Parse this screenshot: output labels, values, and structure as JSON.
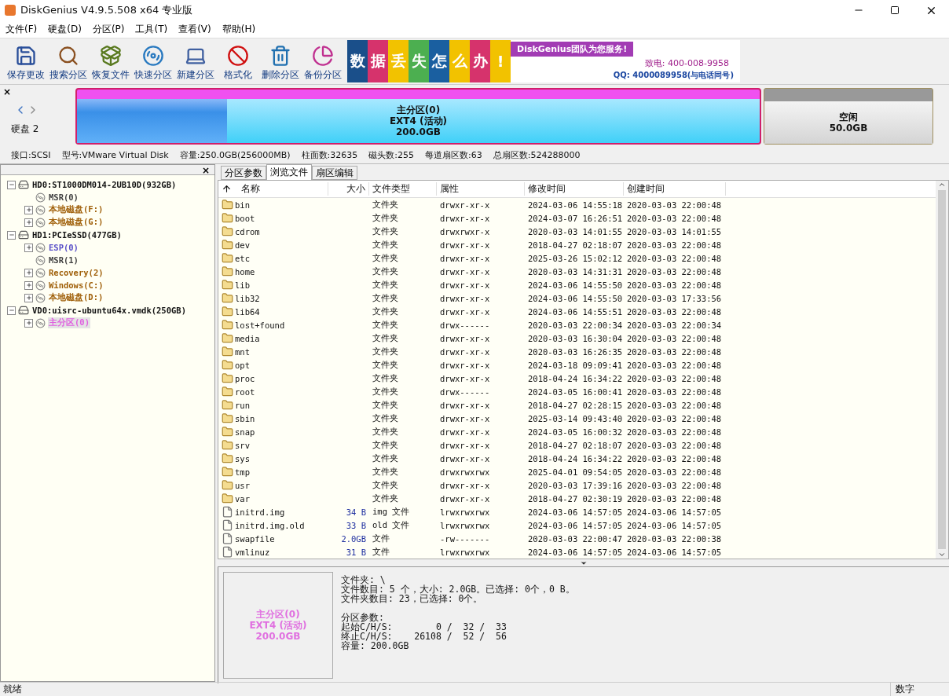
{
  "window": {
    "title": "DiskGenius V4.9.5.508 x64 专业版"
  },
  "menu": [
    "文件(F)",
    "硬盘(D)",
    "分区(P)",
    "工具(T)",
    "查看(V)",
    "帮助(H)"
  ],
  "toolbar": [
    {
      "label": "保存更改",
      "kind": "save"
    },
    {
      "label": "搜索分区",
      "kind": "search"
    },
    {
      "label": "恢复文件",
      "kind": "recover"
    },
    {
      "label": "快速分区",
      "kind": "quick"
    },
    {
      "label": "新建分区",
      "kind": "new"
    },
    {
      "label": "格式化",
      "kind": "format"
    },
    {
      "label": "删除分区",
      "kind": "delete"
    },
    {
      "label": "备份分区",
      "kind": "backup"
    }
  ],
  "banner": {
    "tiles": [
      {
        "text": "数",
        "color": "#1a4f8a"
      },
      {
        "text": "据",
        "color": "#d6336c"
      },
      {
        "text": "丢",
        "color": "#f2c200"
      },
      {
        "text": "失",
        "color": "#4caf50"
      },
      {
        "text": "怎",
        "color": "#1a5fa0"
      },
      {
        "text": "么",
        "color": "#f2c200"
      },
      {
        "text": "办",
        "color": "#d6336c"
      },
      {
        "text": "!",
        "color": "#f2c200"
      }
    ],
    "slogan": "DiskGenius团队为您服务!",
    "phone": "致电: 400-008-9958",
    "qq": "QQ: 4000089958(与电话同号)"
  },
  "disk_bar": {
    "close": "×",
    "disk_label": "硬盘 2",
    "partitions": [
      {
        "kind": "used",
        "name": "主分区(0)",
        "fs": "EXT4 (活动)",
        "size": "200.0GB",
        "level": 0.22
      },
      {
        "kind": "free",
        "name": "空闲",
        "size": "50.0GB"
      }
    ],
    "info": [
      "接口:SCSI",
      "型号:VMware Virtual Disk",
      "容量:250.0GB(256000MB)",
      "柱面数:32635",
      "磁头数:255",
      "每道扇区数:63",
      "总扇区数:524288000"
    ]
  },
  "tree": {
    "close": "×",
    "items": [
      {
        "label": "HD0:ST1000DM014-2UB10D(932GB)",
        "kind": "disk",
        "expanded": true,
        "selected": false,
        "children": [
          {
            "label": "MSR(0)",
            "kind": "reserved",
            "selected": false,
            "color": "#404040"
          },
          {
            "label": "本地磁盘(F:)",
            "kind": "partition",
            "expanded": false,
            "selected": false,
            "color": "#a0600a"
          },
          {
            "label": "本地磁盘(G:)",
            "kind": "partition",
            "expanded": false,
            "selected": false,
            "color": "#a0600a"
          }
        ]
      },
      {
        "label": "HD1:PCIeSSD(477GB)",
        "kind": "disk",
        "expanded": true,
        "selected": false,
        "children": [
          {
            "label": "ESP(0)",
            "kind": "partition",
            "expanded": false,
            "selected": false,
            "color": "#5a50c8"
          },
          {
            "label": "MSR(1)",
            "kind": "reserved",
            "selected": false,
            "color": "#404040"
          },
          {
            "label": "Recovery(2)",
            "kind": "partition",
            "expanded": false,
            "selected": false,
            "color": "#a0600a"
          },
          {
            "label": "Windows(C:)",
            "kind": "partition",
            "expanded": false,
            "selected": false,
            "color": "#a0600a"
          },
          {
            "label": "本地磁盘(D:)",
            "kind": "partition",
            "expanded": false,
            "selected": false,
            "color": "#a0600a"
          }
        ]
      },
      {
        "label": "VD0:uisrc-ubuntu64x.vmdk(250GB)",
        "kind": "disk",
        "expanded": true,
        "selected": false,
        "children": [
          {
            "label": "主分区(0)",
            "kind": "partition",
            "expanded": false,
            "selected": true,
            "color": "#e060e0"
          }
        ]
      }
    ]
  },
  "tabs": [
    {
      "label": "分区参数",
      "selected": false
    },
    {
      "label": "浏览文件",
      "selected": true
    },
    {
      "label": "扇区编辑",
      "selected": false
    }
  ],
  "table": {
    "columns": [
      "名称",
      "大小",
      "文件类型",
      "属性",
      "修改时间",
      "创建时间"
    ],
    "rows": [
      {
        "kind": "folder",
        "name": "bin",
        "size": "",
        "type": "文件夹",
        "attr": "drwxr-xr-x",
        "modified": "2024-03-06 14:55:18",
        "created": "2020-03-03 22:00:48"
      },
      {
        "kind": "folder",
        "name": "boot",
        "size": "",
        "type": "文件夹",
        "attr": "drwxr-xr-x",
        "modified": "2024-03-07 16:26:51",
        "created": "2020-03-03 22:00:48"
      },
      {
        "kind": "folder",
        "name": "cdrom",
        "size": "",
        "type": "文件夹",
        "attr": "drwxrwxr-x",
        "modified": "2020-03-03 14:01:55",
        "created": "2020-03-03 14:01:55"
      },
      {
        "kind": "folder",
        "name": "dev",
        "size": "",
        "type": "文件夹",
        "attr": "drwxr-xr-x",
        "modified": "2018-04-27 02:18:07",
        "created": "2020-03-03 22:00:48"
      },
      {
        "kind": "folder",
        "name": "etc",
        "size": "",
        "type": "文件夹",
        "attr": "drwxr-xr-x",
        "modified": "2025-03-26 15:02:12",
        "created": "2020-03-03 22:00:48"
      },
      {
        "kind": "folder",
        "name": "home",
        "size": "",
        "type": "文件夹",
        "attr": "drwxr-xr-x",
        "modified": "2020-03-03 14:31:31",
        "created": "2020-03-03 22:00:48"
      },
      {
        "kind": "folder",
        "name": "lib",
        "size": "",
        "type": "文件夹",
        "attr": "drwxr-xr-x",
        "modified": "2024-03-06 14:55:50",
        "created": "2020-03-03 22:00:48"
      },
      {
        "kind": "folder",
        "name": "lib32",
        "size": "",
        "type": "文件夹",
        "attr": "drwxr-xr-x",
        "modified": "2024-03-06 14:55:50",
        "created": "2020-03-03 17:33:56"
      },
      {
        "kind": "folder",
        "name": "lib64",
        "size": "",
        "type": "文件夹",
        "attr": "drwxr-xr-x",
        "modified": "2024-03-06 14:55:51",
        "created": "2020-03-03 22:00:48"
      },
      {
        "kind": "folder",
        "name": "lost+found",
        "size": "",
        "type": "文件夹",
        "attr": "drwx------",
        "modified": "2020-03-03 22:00:34",
        "created": "2020-03-03 22:00:34"
      },
      {
        "kind": "folder",
        "name": "media",
        "size": "",
        "type": "文件夹",
        "attr": "drwxr-xr-x",
        "modified": "2020-03-03 16:30:04",
        "created": "2020-03-03 22:00:48"
      },
      {
        "kind": "folder",
        "name": "mnt",
        "size": "",
        "type": "文件夹",
        "attr": "drwxr-xr-x",
        "modified": "2020-03-03 16:26:35",
        "created": "2020-03-03 22:00:48"
      },
      {
        "kind": "folder",
        "name": "opt",
        "size": "",
        "type": "文件夹",
        "attr": "drwxr-xr-x",
        "modified": "2024-03-18 09:09:41",
        "created": "2020-03-03 22:00:48"
      },
      {
        "kind": "folder",
        "name": "proc",
        "size": "",
        "type": "文件夹",
        "attr": "drwxr-xr-x",
        "modified": "2018-04-24 16:34:22",
        "created": "2020-03-03 22:00:48"
      },
      {
        "kind": "folder",
        "name": "root",
        "size": "",
        "type": "文件夹",
        "attr": "drwx------",
        "modified": "2024-03-05 16:00:41",
        "created": "2020-03-03 22:00:48"
      },
      {
        "kind": "folder",
        "name": "run",
        "size": "",
        "type": "文件夹",
        "attr": "drwxr-xr-x",
        "modified": "2018-04-27 02:28:15",
        "created": "2020-03-03 22:00:48"
      },
      {
        "kind": "folder",
        "name": "sbin",
        "size": "",
        "type": "文件夹",
        "attr": "drwxr-xr-x",
        "modified": "2025-03-14 09:43:40",
        "created": "2020-03-03 22:00:48"
      },
      {
        "kind": "folder",
        "name": "snap",
        "size": "",
        "type": "文件夹",
        "attr": "drwxr-xr-x",
        "modified": "2024-03-05 16:00:32",
        "created": "2020-03-03 22:00:48"
      },
      {
        "kind": "folder",
        "name": "srv",
        "size": "",
        "type": "文件夹",
        "attr": "drwxr-xr-x",
        "modified": "2018-04-27 02:18:07",
        "created": "2020-03-03 22:00:48"
      },
      {
        "kind": "folder",
        "name": "sys",
        "size": "",
        "type": "文件夹",
        "attr": "drwxr-xr-x",
        "modified": "2018-04-24 16:34:22",
        "created": "2020-03-03 22:00:48"
      },
      {
        "kind": "folder",
        "name": "tmp",
        "size": "",
        "type": "文件夹",
        "attr": "drwxrwxrwx",
        "modified": "2025-04-01 09:54:05",
        "created": "2020-03-03 22:00:48"
      },
      {
        "kind": "folder",
        "name": "usr",
        "size": "",
        "type": "文件夹",
        "attr": "drwxr-xr-x",
        "modified": "2020-03-03 17:39:16",
        "created": "2020-03-03 22:00:48"
      },
      {
        "kind": "folder",
        "name": "var",
        "size": "",
        "type": "文件夹",
        "attr": "drwxr-xr-x",
        "modified": "2018-04-27 02:30:19",
        "created": "2020-03-03 22:00:48"
      },
      {
        "kind": "file",
        "name": "initrd.img",
        "size": "34 B",
        "type": "img 文件",
        "attr": "lrwxrwxrwx",
        "modified": "2024-03-06 14:57:05",
        "created": "2024-03-06 14:57:05"
      },
      {
        "kind": "file",
        "name": "initrd.img.old",
        "size": "33 B",
        "type": "old 文件",
        "attr": "lrwxrwxrwx",
        "modified": "2024-03-06 14:57:05",
        "created": "2024-03-06 14:57:05"
      },
      {
        "kind": "file",
        "name": "swapfile",
        "size": "2.0GB",
        "type": "文件",
        "attr": "-rw-------",
        "modified": "2020-03-03 22:00:47",
        "created": "2020-03-03 22:00:38"
      },
      {
        "kind": "file",
        "name": "vmlinuz",
        "size": "31 B",
        "type": "文件",
        "attr": "lrwxrwxrwx",
        "modified": "2024-03-06 14:57:05",
        "created": "2024-03-06 14:57:05"
      }
    ]
  },
  "details": {
    "partition_card": [
      "主分区(0)",
      "EXT4 (活动)",
      "200.0GB"
    ],
    "folder_info": [
      "文件夹: \\",
      "文件数目: 5 个，大小: 2.0GB。已选择: 0个，0 B。",
      "文件夹数目: 23，已选择: 0个。"
    ],
    "partition_params": [
      "分区参数:",
      "起始C/H/S:        0 /  32 /  33",
      "终止C/H/S:    26108 /  52 /  56",
      "容量: 200.0GB"
    ]
  },
  "status_bar": {
    "left": "就绪",
    "right": "数字"
  }
}
